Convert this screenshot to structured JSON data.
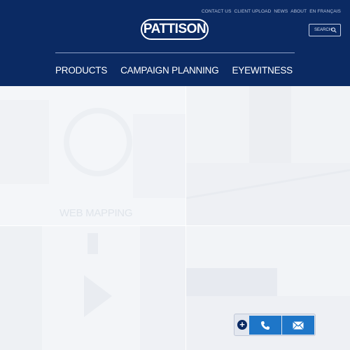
{
  "header": {
    "top_links": [
      "CONTACT US",
      "CLIENT UPLOAD",
      "NEWS",
      "ABOUT",
      "EN FRANÇAIS"
    ],
    "logo_text": "PATTISON",
    "search_label": "SEARCH",
    "nav": [
      "PRODUCTS",
      "CAMPAIGN PLANNING",
      "EYEWITNESS"
    ]
  },
  "tiles": {
    "web_mapping_label": "WEB MAPPING"
  },
  "contact_widget": {
    "expand_icon": "plus-circle-icon",
    "phone_icon": "phone-icon",
    "email_icon": "envelope-icon"
  },
  "colors": {
    "header_bg": "#0b2a63",
    "button_blue": "#1e76c8"
  }
}
